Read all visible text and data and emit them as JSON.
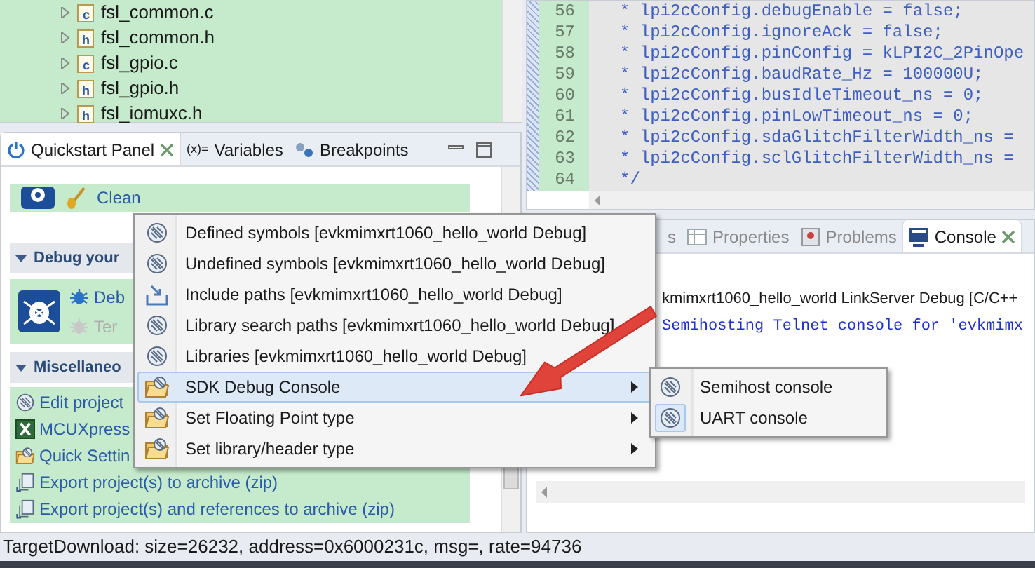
{
  "project_tree": {
    "items": [
      {
        "kind": "c",
        "label": "fsl_common.c",
        "expanded": false
      },
      {
        "kind": "h",
        "label": "fsl_common.h",
        "expanded": false
      },
      {
        "kind": "c",
        "label": "fsl_gpio.c",
        "expanded": false
      },
      {
        "kind": "h",
        "label": "fsl_gpio.h",
        "expanded": false
      },
      {
        "kind": "h",
        "label": "fsl_iomuxc.h",
        "expanded": false
      }
    ]
  },
  "editor": {
    "lines": [
      {
        "number": "56",
        "code": "* lpi2cConfig.debugEnable = false;"
      },
      {
        "number": "57",
        "code": "* lpi2cConfig.ignoreAck = false;"
      },
      {
        "number": "58",
        "code": "* lpi2cConfig.pinConfig = kLPI2C_2PinOpe"
      },
      {
        "number": "59",
        "code": "* lpi2cConfig.baudRate_Hz = 100000U;"
      },
      {
        "number": "60",
        "code": "* lpi2cConfig.busIdleTimeout_ns = 0;"
      },
      {
        "number": "61",
        "code": "* lpi2cConfig.pinLowTimeout_ns = 0;"
      },
      {
        "number": "62",
        "code": "* lpi2cConfig.sdaGlitchFilterWidth_ns ="
      },
      {
        "number": "63",
        "code": "* lpi2cConfig.sclGlitchFilterWidth_ns ="
      },
      {
        "number": "64",
        "code": "*/"
      }
    ]
  },
  "quickstart_panel": {
    "tabs": [
      {
        "kind": "quickstart",
        "label": "Quickstart Panel",
        "selected": true
      },
      {
        "kind": "variables",
        "icon_text": "(x)=",
        "label": "Variables",
        "selected": false
      },
      {
        "kind": "breakpoints",
        "label": "Breakpoints",
        "selected": false
      }
    ],
    "clean_label": "Clean",
    "sections": [
      {
        "title": "Debug your",
        "expanded": true,
        "items": [
          {
            "kind": "debug",
            "label": "Deb"
          },
          {
            "kind": "terminate",
            "label": "Ter"
          }
        ]
      },
      {
        "title": "Miscellaneo",
        "expanded": true,
        "items": [
          {
            "kind": "settings",
            "label": "Edit project"
          },
          {
            "kind": "excel",
            "label": "MCUXpress"
          },
          {
            "kind": "folder",
            "label": "Quick Settin"
          },
          {
            "kind": "export",
            "label": "Export project(s) to archive (zip)"
          },
          {
            "kind": "export",
            "label": "Export project(s) and references to archive (zip)"
          }
        ]
      }
    ]
  },
  "console_panel": {
    "tabs": [
      {
        "kind": "hidden",
        "label": "s",
        "selected": false
      },
      {
        "kind": "properties",
        "label": "Properties",
        "selected": false
      },
      {
        "kind": "problems",
        "label": "Problems",
        "selected": false
      },
      {
        "kind": "console",
        "label": "Console",
        "selected": true
      }
    ],
    "lines": [
      {
        "kind": "header",
        "text": "kmimxrt1060_hello_world LinkServer Debug [C/C++"
      },
      {
        "kind": "output",
        "text": "Semihosting Telnet console for 'evkmimx"
      }
    ]
  },
  "context_menu": {
    "items": [
      {
        "kind": "settings",
        "label": "Defined symbols [evkmimxrt1060_hello_world Debug]",
        "submenu": false,
        "selected": false
      },
      {
        "kind": "settings",
        "label": "Undefined symbols [evkmimxrt1060_hello_world Debug]",
        "submenu": false,
        "selected": false
      },
      {
        "kind": "include",
        "label": "Include paths [evkmimxrt1060_hello_world Debug]",
        "submenu": false,
        "selected": false
      },
      {
        "kind": "settings",
        "label": "Library search paths [evkmimxrt1060_hello_world Debug]",
        "submenu": false,
        "selected": false
      },
      {
        "kind": "settings",
        "label": "Libraries [evkmimxrt1060_hello_world Debug]",
        "submenu": false,
        "selected": false
      },
      {
        "kind": "folder",
        "label": "SDK Debug Console",
        "submenu": true,
        "selected": true
      },
      {
        "kind": "folder",
        "label": "Set Floating Point type",
        "submenu": true,
        "selected": false
      },
      {
        "kind": "folder",
        "label": "Set library/header type",
        "submenu": true,
        "selected": false
      }
    ]
  },
  "submenu": {
    "items": [
      {
        "label": "Semihost console",
        "checked": false
      },
      {
        "label": "UART console",
        "checked": true
      }
    ]
  },
  "status_bar": {
    "text": "TargetDownload: size=26232, address=0x6000231c, msg=, rate=94736"
  }
}
